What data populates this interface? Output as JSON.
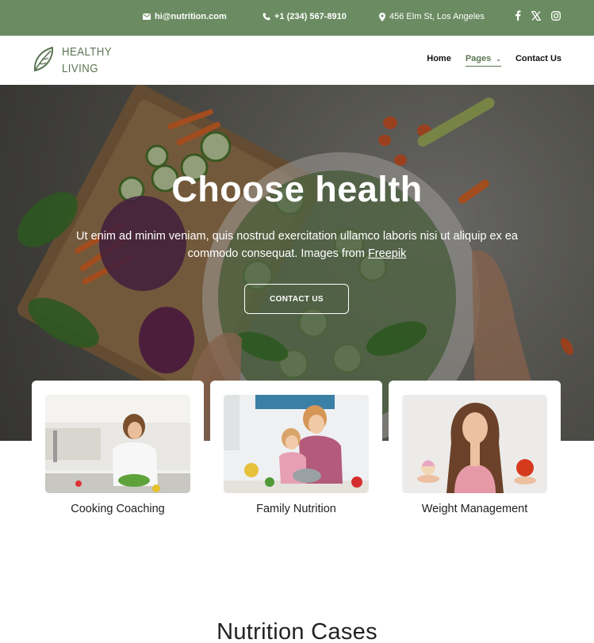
{
  "topbar": {
    "email": "hi@nutrition.com",
    "phone": "+1 (234) 567-8910",
    "address": "456 Elm St, Los Angeles",
    "socials": [
      "facebook-icon",
      "x-icon",
      "instagram-icon"
    ],
    "bg_color": "#6b8c62"
  },
  "logo": {
    "line1": "HEALTHY",
    "line2": "LIVING",
    "color": "#5b7552"
  },
  "nav": {
    "home": "Home",
    "pages": "Pages",
    "contact": "Contact Us"
  },
  "hero": {
    "title": "Choose health",
    "text": "Ut enim ad minim veniam, quis nostrud exercitation ullamco laboris nisi ut aliquip ex ea commodo consequat. Images from",
    "link": "Freepik",
    "button": "CONTACT US"
  },
  "cards": [
    {
      "label": "Cooking Coaching"
    },
    {
      "label": "Family Nutrition"
    },
    {
      "label": "Weight Management"
    }
  ],
  "section": {
    "title": "Nutrition Cases"
  }
}
